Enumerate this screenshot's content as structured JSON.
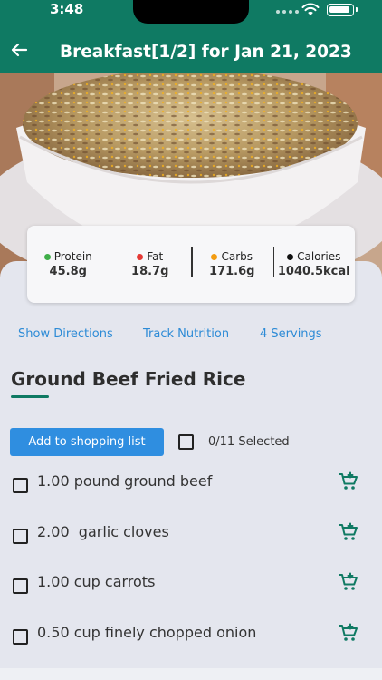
{
  "status_bar": {
    "time": "3:48"
  },
  "app_bar": {
    "title": "Breakfast[1/2] for Jan 21, 2023",
    "back_icon": "arrow-left-icon"
  },
  "hero_image": {
    "subject": "ground-beef-fried-rice-photo"
  },
  "nutrition": [
    {
      "label": "Protein",
      "value": "45.8g",
      "color": "#3fae49"
    },
    {
      "label": "Fat",
      "value": "18.7g",
      "color": "#e53935"
    },
    {
      "label": "Carbs",
      "value": "171.6g",
      "color": "#f39c12"
    },
    {
      "label": "Calories",
      "value": "1040.5kcal",
      "color": "#111111"
    }
  ],
  "links": {
    "directions": "Show Directions",
    "track": "Track Nutrition",
    "servings": "4 Servings"
  },
  "recipe": {
    "title": "Ground Beef Fried Rice"
  },
  "shopping": {
    "button": "Add to shopping list",
    "selected": "0/11 Selected"
  },
  "ingredients": [
    {
      "text": "1.00 pound ground beef"
    },
    {
      "text": "2.00  garlic cloves"
    },
    {
      "text": "1.00 cup carrots"
    },
    {
      "text": "0.50 cup finely chopped onion"
    }
  ],
  "colors": {
    "primary": "#0f7a63",
    "accent_blue": "#2f8ee0",
    "link": "#2d8bd6"
  }
}
